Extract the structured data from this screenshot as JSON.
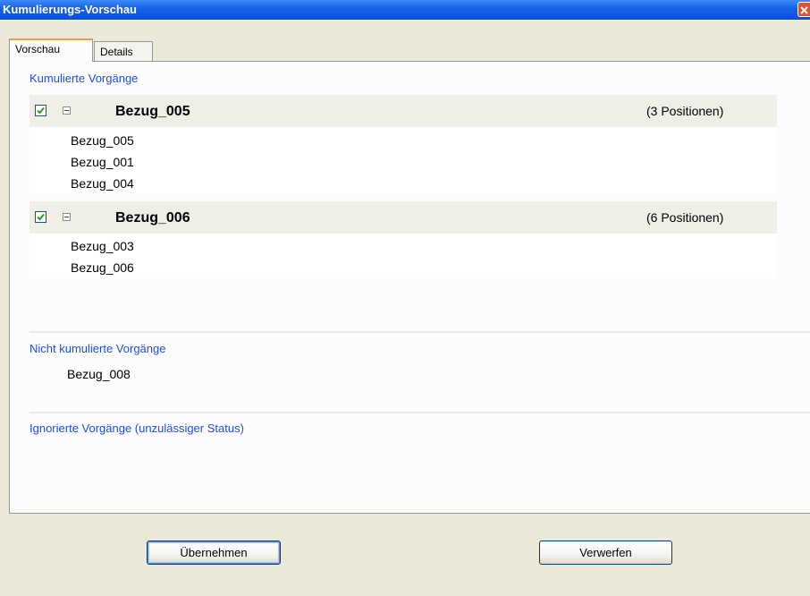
{
  "window": {
    "title": "Kumulierungs-Vorschau"
  },
  "tabs": [
    {
      "label": "Vorschau",
      "active": true
    },
    {
      "label": "Details",
      "active": false
    }
  ],
  "cumulated": {
    "label": "Kumulierte Vorgänge",
    "groups": [
      {
        "title": "Bezug_005",
        "count": "(3 Positionen)",
        "checked": true,
        "expanded": true,
        "items": [
          "Bezug_005",
          "Bezug_001",
          "Bezug_004"
        ]
      },
      {
        "title": "Bezug_006",
        "count": "(6 Positionen)",
        "checked": true,
        "expanded": true,
        "items": [
          "Bezug_003",
          "Bezug_006"
        ]
      }
    ]
  },
  "not_cumulated": {
    "label": "Nicht kumulierte Vorgänge",
    "items": [
      "Bezug_008"
    ]
  },
  "ignored": {
    "label": "Ignorierte Vorgänge (unzulässiger Status)"
  },
  "buttons": {
    "apply": "Übernehmen",
    "discard": "Verwerfen"
  },
  "colors": {
    "section_label": "#1f4fd8",
    "group_header_bg": "#efeee7",
    "titlebar": "#0a4fd6",
    "checkmark": "#21a121"
  },
  "icons": {
    "close": "close-icon",
    "checkbox": "checkbox-checked-icon",
    "expander": "collapse-minus-icon"
  }
}
